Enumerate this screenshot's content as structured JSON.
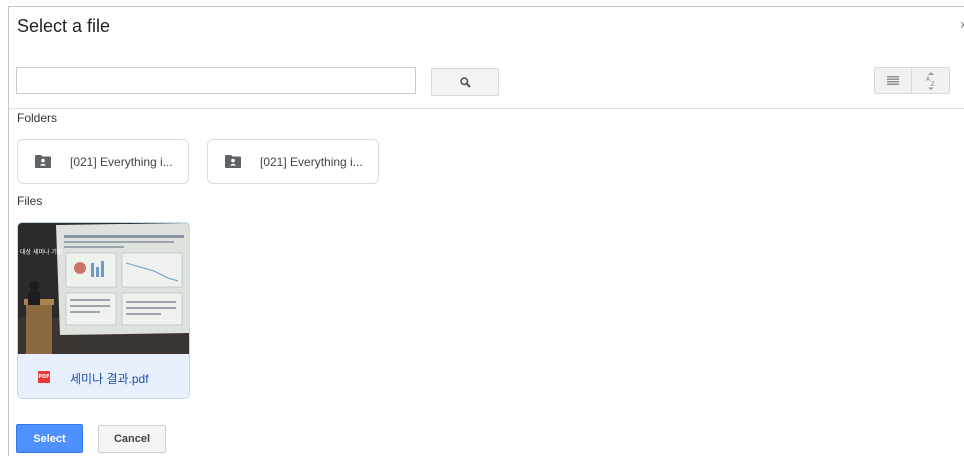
{
  "dialog": {
    "title": "Select a file",
    "close_label": "x"
  },
  "search": {
    "value": "",
    "placeholder": ""
  },
  "icons": {
    "search": "search-icon",
    "list_view": "list-view-icon",
    "sort": "sort-az-icon",
    "folder": "shared-folder-icon",
    "pdf": "pdf-icon"
  },
  "sort_label": "A Z",
  "sections": {
    "folders": "Folders",
    "files": "Files"
  },
  "folders": [
    {
      "label": "[021] Everything i..."
    },
    {
      "label": "[021] Everything i..."
    }
  ],
  "files": [
    {
      "name": "세미나 결과.pdf",
      "type_badge": "PDF",
      "thumbnail_caption": "대상 세미나 기획"
    }
  ],
  "actions": {
    "select": "Select",
    "cancel": "Cancel"
  },
  "colors": {
    "primary": "#4d90fe",
    "pdf_red": "#e53935",
    "link_blue": "#1a4fa3",
    "card_bg": "#e8f0fe"
  }
}
